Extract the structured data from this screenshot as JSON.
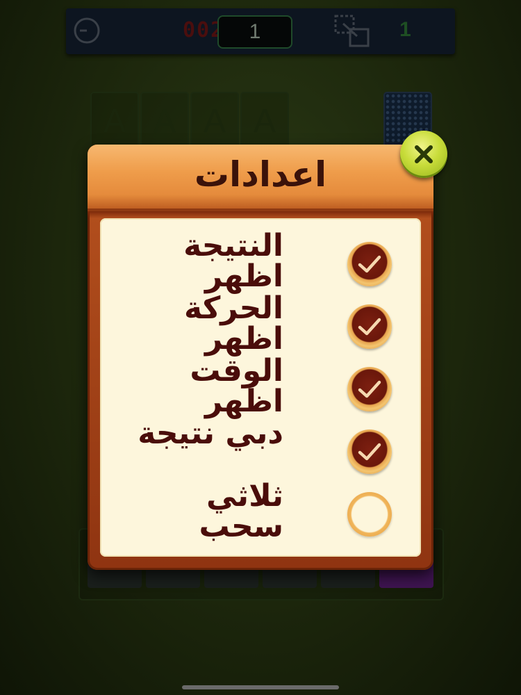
{
  "topbar": {
    "timer": "002",
    "score": "1",
    "moves": "1"
  },
  "foundations": [
    "A",
    "A",
    "A",
    "A"
  ],
  "dialog": {
    "title": "اعدادات",
    "settings": [
      {
        "label": "النتيجة اظهر",
        "checked": true
      },
      {
        "label": "الحركة اظهر",
        "checked": true
      },
      {
        "label": "الوقت اظهر",
        "checked": true
      },
      {
        "label": "دبي نتيجة",
        "checked": true
      },
      {
        "label": "ثلاثي سحب",
        "checked": false
      }
    ]
  },
  "icons": {
    "timer": "clock-icon",
    "moves": "moves-icon",
    "close": "close-icon",
    "check": "check-icon"
  },
  "colors": {
    "dialog_header": "#ef9d4b",
    "dialog_body": "#a8461a",
    "panel": "#fdf6dc",
    "label_text": "#4a0d0a",
    "close_button": "#c8dc3a"
  }
}
